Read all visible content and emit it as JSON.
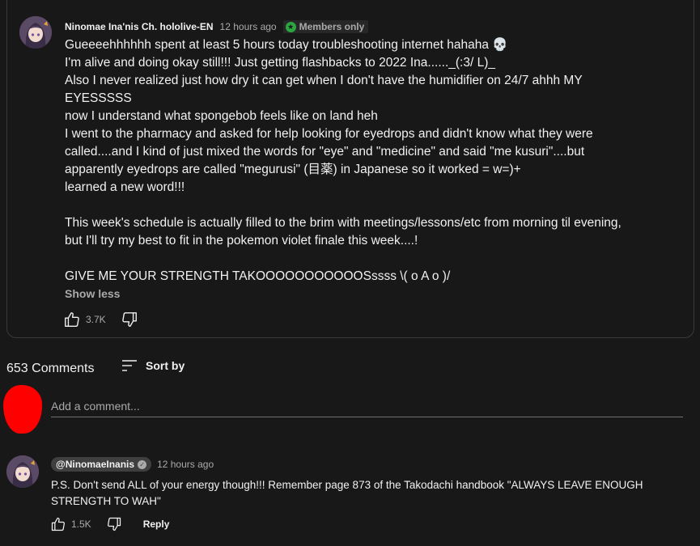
{
  "post": {
    "channel_name": "Ninomae Ina'nis Ch. hololive-EN",
    "timestamp": "12 hours ago",
    "members_badge": "Members only",
    "lines": [
      "Gueeeehhhhhh spent at least 5 hours today troubleshooting internet hahaha 💀",
      "I'm alive and doing okay still!!! Just getting flashbacks to 2022 Ina......_(:3/ L)_",
      "Also I never realized just how dry it can get when I don't have the humidifier on 24/7 ahhh MY",
      "EYESSSSS",
      "now I understand what spongebob feels like on land heh",
      "I went to the pharmacy and asked for help looking for eyedrops and didn't know what they were",
      "called....and I kind of just mixed the words for \"eye\" and \"medicine\" and said \"me kusuri\"....but",
      "apparently eyedrops are called \"megurusi\" (目薬) in Japanese so it worked = w=)+",
      "learned a new word!!!",
      "",
      "This week's schedule is actually filled to the brim with meetings/lessons/etc from morning til evening,",
      "but I'll try my best to fit in the pokemon violet finale this week....!",
      "",
      "GIVE ME YOUR STRENGTH TAKOOOOOOOOOOOSssss \\( o A o )/"
    ],
    "show_less_label": "Show less",
    "like_count": "3.7K"
  },
  "comments_section": {
    "count_label": "653 Comments",
    "sort_label": "Sort by",
    "add_comment_placeholder": "Add a comment..."
  },
  "comment": {
    "author": "@NinomaeInanis",
    "timestamp": "12 hours ago",
    "text_lines": [
      "P.S. Don't send ALL of your energy though!!! Remember page 873 of the Takodachi handbook \"ALWAYS LEAVE ENOUGH",
      "STRENGTH TO WAH\""
    ],
    "like_count": "1.5K",
    "reply_label": "Reply"
  },
  "colors": {
    "background": "#181818",
    "text": "#f1f1f1",
    "secondary_text": "#aaaaaa",
    "members_badge_icon": "#2ba640",
    "redaction": "#ff0000"
  },
  "icons": [
    "thumbs-up-icon",
    "thumbs-down-icon",
    "sort-icon",
    "verified-check-icon",
    "members-star-icon"
  ]
}
